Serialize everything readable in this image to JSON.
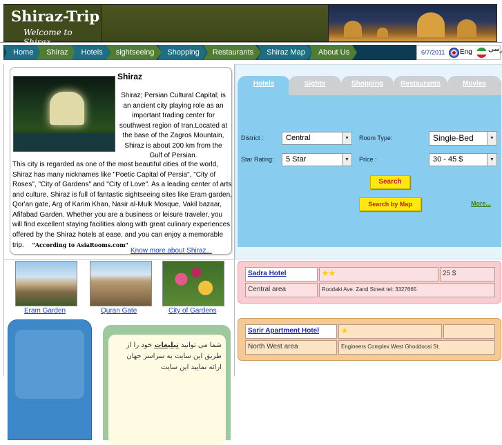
{
  "header": {
    "logo_title": "Shiraz-Trip",
    "logo_subtitle": "Welcome to Shiraz"
  },
  "nav": {
    "items": [
      {
        "label": "Home"
      },
      {
        "label": "Shiraz"
      },
      {
        "label": "Hotels"
      },
      {
        "label": "sightseeing"
      },
      {
        "label": "Shopping"
      },
      {
        "label": "Restaurants"
      },
      {
        "label": "Shiraz Map"
      },
      {
        "label": "About Us"
      }
    ],
    "date": "6/7/2011",
    "lang_en": "Eng",
    "lang_fa": "فارسی"
  },
  "intro": {
    "title": "Shiraz",
    "lead": "Shiraz; Persian Cultural Capital; is an ancient city playing role as an important trading center for southwest region of Iran.Located at the base of the Zagros Mountain, Shiraz is about 200 km from the Gulf of Persian.",
    "body": "This city is regarded as one of the most beautiful cities of the world, Shiraz has many nicknames like \"Poetic Capital of Persia\", \"City of Roses\", \"City of Gardens\" and \"City of Love\". As a leading center of arts and culture, Shiraz is full of fantastic sightseeing sites like Eram garden, Qor'an gate, Arg of Karim Khan, Nasir al-Mulk Mosque, Vakil bazaar, Afifabad Garden. Whether you are a business or leisure traveler, you will find excellent staying facilities along with great culinary experiences offered by the Shiraz hotels at ease. and you can enjoy a memorable trip.",
    "quote": "\"According to AsiaRooms.com\"",
    "more_link": "Know more about Shiraz..."
  },
  "thumbs": [
    {
      "label": "Eram Garden"
    },
    {
      "label": "Quran Gate"
    },
    {
      "label": "City of Gardens"
    }
  ],
  "ad": {
    "text_pre": "شما می توانید",
    "text_bold": "تبلیغات",
    "text_post": "خود را از طریق این سایت به سراسر جهان ارائه نمایید این سایت"
  },
  "search": {
    "tabs": [
      {
        "label": "Hotels"
      },
      {
        "label": "Sights"
      },
      {
        "label": "Shopping"
      },
      {
        "label": "Restaurants"
      },
      {
        "label": "Movies"
      }
    ],
    "district_label": "District :",
    "district_value": "Central",
    "room_type_label": "Room Type:",
    "room_type_value": "Single-Bed",
    "star_label": "Star Rating:",
    "star_value": "5 Star",
    "price_label": "Price :",
    "price_value": "30 - 45 $",
    "search_button": "Search",
    "map_button": "Search by Map",
    "more_link": "More..."
  },
  "hotels": [
    {
      "name": "Sadra Hotel",
      "stars": 2,
      "price": "25 $",
      "area": "Central area",
      "address": "Roodaki Ave. Zand Street tel: 3327665"
    },
    {
      "name": "Sarir Apartment Hotel",
      "stars": 1,
      "price": "",
      "area": "North West area",
      "address": "Engineers Complex West Ghoddoosi St."
    }
  ]
}
